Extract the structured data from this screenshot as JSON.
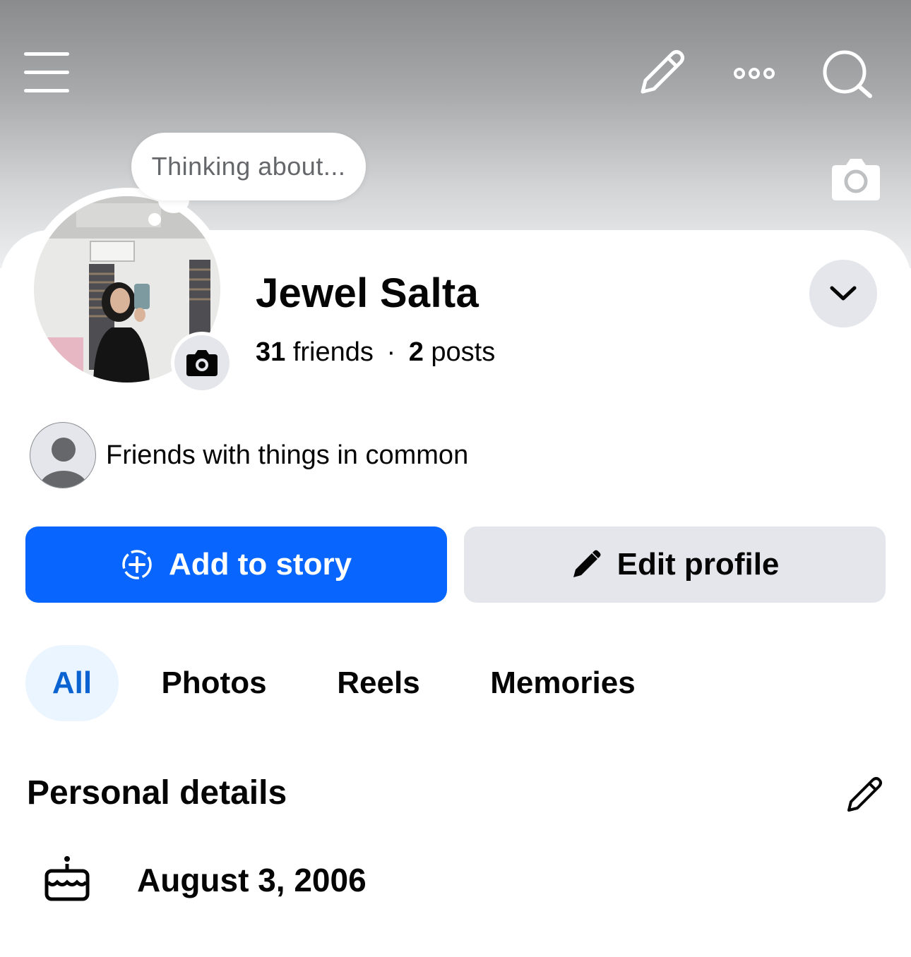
{
  "header": {
    "menu_icon": "menu-icon",
    "edit_icon": "pencil-icon",
    "more_icon": "more-icon",
    "search_icon": "search-icon"
  },
  "cover": {
    "camera_icon": "camera-icon"
  },
  "note": {
    "placeholder": "Thinking about..."
  },
  "profile": {
    "name": "Jewel Salta",
    "friends_count": "31",
    "friends_label": "friends",
    "separator": "·",
    "posts_count": "2",
    "posts_label": "posts",
    "avatar_camera_icon": "camera-icon",
    "dropdown_icon": "chevron-down-icon"
  },
  "mutual": {
    "text": "Friends with things in common"
  },
  "actions": {
    "add_story_label": "Add to story",
    "edit_profile_label": "Edit profile"
  },
  "tabs": [
    {
      "label": "All",
      "active": true
    },
    {
      "label": "Photos",
      "active": false
    },
    {
      "label": "Reels",
      "active": false
    },
    {
      "label": "Memories",
      "active": false
    }
  ],
  "personal_details": {
    "title": "Personal details",
    "birthday": "August 3, 2006",
    "birthday_icon": "cake-icon"
  },
  "colors": {
    "accent": "#0866ff",
    "active_tab_bg": "#ebf5ff",
    "active_tab_text": "#0a63d1",
    "button_gray": "#e4e6eb"
  }
}
